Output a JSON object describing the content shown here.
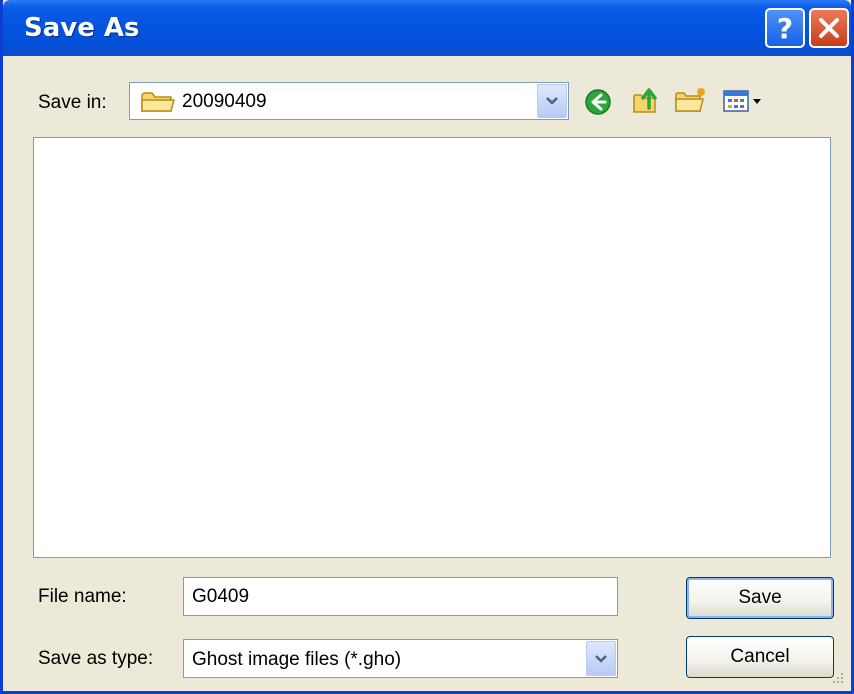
{
  "window": {
    "title": "Save As",
    "help_label": "?",
    "accent": "#0454e0"
  },
  "save_in": {
    "label": "Save in:",
    "value": "20090409"
  },
  "toolbar": {
    "icons": [
      "back-icon",
      "up-folder-icon",
      "new-folder-icon",
      "views-menu-icon"
    ]
  },
  "file_list": {
    "items": []
  },
  "file_name": {
    "label": "File name:",
    "value": "G0409"
  },
  "save_as_type": {
    "label": "Save as type:",
    "value": "Ghost image files (*.gho)"
  },
  "buttons": {
    "save": "Save",
    "cancel": "Cancel"
  }
}
